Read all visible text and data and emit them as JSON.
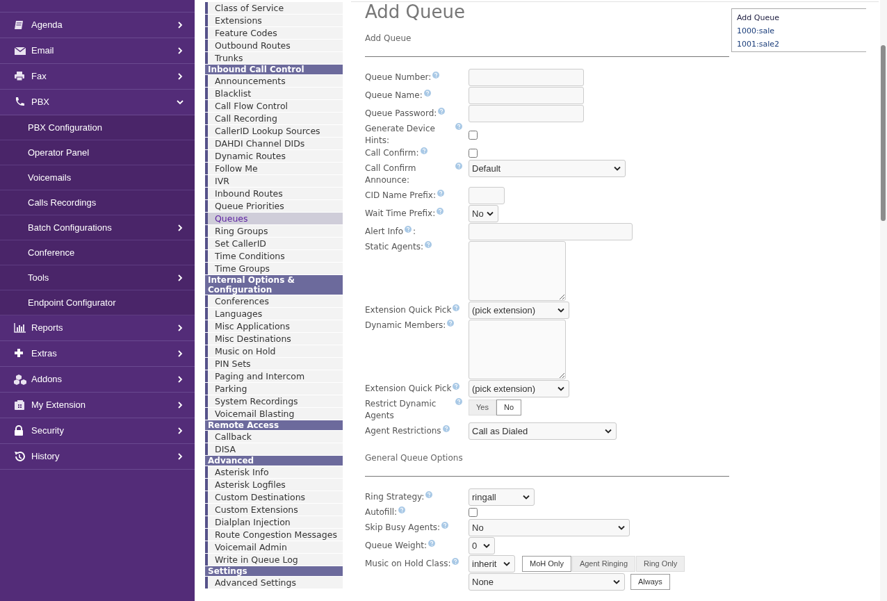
{
  "sidebar": {
    "items": [
      {
        "label": "Agenda",
        "expanded": false,
        "has_children": true
      },
      {
        "label": "Email",
        "expanded": false,
        "has_children": true
      },
      {
        "label": "Fax",
        "expanded": false,
        "has_children": true
      },
      {
        "label": "PBX",
        "expanded": true,
        "has_children": true,
        "children": [
          {
            "label": "PBX Configuration",
            "has_children": false
          },
          {
            "label": "Operator Panel",
            "has_children": false
          },
          {
            "label": "Voicemails",
            "has_children": false
          },
          {
            "label": "Calls Recordings",
            "has_children": false
          },
          {
            "label": "Batch Configurations",
            "has_children": true
          },
          {
            "label": "Conference",
            "has_children": false
          },
          {
            "label": "Tools",
            "has_children": true
          },
          {
            "label": "Endpoint Configurator",
            "has_children": false
          }
        ]
      },
      {
        "label": "Reports",
        "expanded": false,
        "has_children": true
      },
      {
        "label": "Extras",
        "expanded": false,
        "has_children": true
      },
      {
        "label": "Addons",
        "expanded": false,
        "has_children": true
      },
      {
        "label": "My Extension",
        "expanded": false,
        "has_children": true
      },
      {
        "label": "Security",
        "expanded": false,
        "has_children": true
      },
      {
        "label": "History",
        "expanded": false,
        "has_children": true
      }
    ]
  },
  "module_menu": {
    "sections": [
      {
        "items": [
          {
            "label": "Class of Service",
            "selected": false
          },
          {
            "label": "Extensions",
            "selected": false
          },
          {
            "label": "Feature Codes",
            "selected": false
          },
          {
            "label": "Outbound Routes",
            "selected": false
          },
          {
            "label": "Trunks",
            "selected": false
          }
        ]
      },
      {
        "header": "Inbound Call Control",
        "items": [
          {
            "label": "Announcements",
            "selected": false
          },
          {
            "label": "Blacklist",
            "selected": false
          },
          {
            "label": "Call Flow Control",
            "selected": false
          },
          {
            "label": "Call Recording",
            "selected": false
          },
          {
            "label": "CallerID Lookup Sources",
            "selected": false
          },
          {
            "label": "DAHDI Channel DIDs",
            "selected": false
          },
          {
            "label": "Dynamic Routes",
            "selected": false
          },
          {
            "label": "Follow Me",
            "selected": false
          },
          {
            "label": "IVR",
            "selected": false
          },
          {
            "label": "Inbound Routes",
            "selected": false
          },
          {
            "label": "Queue Priorities",
            "selected": false
          },
          {
            "label": "Queues",
            "selected": true
          },
          {
            "label": "Ring Groups",
            "selected": false
          },
          {
            "label": "Set CallerID",
            "selected": false
          },
          {
            "label": "Time Conditions",
            "selected": false
          },
          {
            "label": "Time Groups",
            "selected": false
          }
        ]
      },
      {
        "header": "Internal Options & Configuration",
        "items": [
          {
            "label": "Conferences",
            "selected": false
          },
          {
            "label": "Languages",
            "selected": false
          },
          {
            "label": "Misc Applications",
            "selected": false
          },
          {
            "label": "Misc Destinations",
            "selected": false
          },
          {
            "label": "Music on Hold",
            "selected": false
          },
          {
            "label": "PIN Sets",
            "selected": false
          },
          {
            "label": "Paging and Intercom",
            "selected": false
          },
          {
            "label": "Parking",
            "selected": false
          },
          {
            "label": "System Recordings",
            "selected": false
          },
          {
            "label": "Voicemail Blasting",
            "selected": false
          }
        ]
      },
      {
        "header": "Remote Access",
        "items": [
          {
            "label": "Callback",
            "selected": false
          },
          {
            "label": "DISA",
            "selected": false
          }
        ]
      },
      {
        "header": "Advanced",
        "items": [
          {
            "label": "Asterisk Info",
            "selected": false
          },
          {
            "label": "Asterisk Logfiles",
            "selected": false
          },
          {
            "label": "Custom Destinations",
            "selected": false
          },
          {
            "label": "Custom Extensions",
            "selected": false
          },
          {
            "label": "Dialplan Injection",
            "selected": false
          },
          {
            "label": "Route Congestion Messages",
            "selected": false
          },
          {
            "label": "Voicemail Admin",
            "selected": false
          },
          {
            "label": "Write in Queue Log",
            "selected": false
          }
        ]
      },
      {
        "header": "Settings",
        "items": [
          {
            "label": "Advanced Settings",
            "selected": false
          }
        ]
      }
    ]
  },
  "form": {
    "title": "Add Queue",
    "sections": [
      {
        "heading": "Add Queue",
        "rows": [
          {
            "label": "Queue Number:",
            "kind": "text"
          },
          {
            "label": "Queue Name:",
            "kind": "text"
          },
          {
            "label": "Queue Password:",
            "kind": "text"
          },
          {
            "label": "Generate Device Hints:",
            "kind": "checkbox",
            "checked": false
          },
          {
            "label": "Call Confirm:",
            "kind": "checkbox",
            "checked": false
          },
          {
            "label": "Call Confirm Announce:",
            "kind": "select",
            "value": "Default"
          },
          {
            "label": "CID Name Prefix:",
            "kind": "text"
          },
          {
            "label": "Wait Time Prefix:",
            "kind": "select",
            "value": "No"
          },
          {
            "label": "Alert Info",
            "suffix": ":",
            "kind": "text"
          },
          {
            "label": "Static Agents:",
            "kind": "textarea"
          },
          {
            "label": "Extension Quick Pick",
            "kind": "select",
            "value": "(pick extension)"
          },
          {
            "label": "Dynamic Members:",
            "kind": "textarea"
          },
          {
            "label": "Extension Quick Pick",
            "kind": "select",
            "value": "(pick extension)"
          },
          {
            "label": "Restrict Dynamic Agents",
            "kind": "toggle",
            "options": [
              {
                "label": "Yes",
                "selected": false
              },
              {
                "label": "No",
                "selected": true
              }
            ]
          },
          {
            "label": "Agent Restrictions",
            "kind": "select",
            "value": "Call as Dialed"
          }
        ]
      },
      {
        "heading": "General Queue Options",
        "rows": [
          {
            "label": "Ring Strategy:",
            "kind": "select",
            "value": "ringall"
          },
          {
            "label": "Autofill:",
            "kind": "checkbox",
            "checked": false
          },
          {
            "label": "Skip Busy Agents:",
            "kind": "select",
            "value": "No"
          },
          {
            "label": "Queue Weight:",
            "kind": "select",
            "value": "0"
          },
          {
            "label": "Music on Hold Class:",
            "kind": "select",
            "value": "inherit",
            "options": [
              {
                "label": "MoH Only",
                "selected": true
              },
              {
                "label": "Agent Ringing",
                "selected": false
              },
              {
                "label": "Ring Only",
                "selected": false
              }
            ]
          },
          {
            "kind": "select",
            "value": "None",
            "button": "Always"
          }
        ]
      }
    ]
  },
  "queue_list": {
    "items": [
      "Add Queue",
      "1000:sale",
      "1001:sale2"
    ]
  }
}
